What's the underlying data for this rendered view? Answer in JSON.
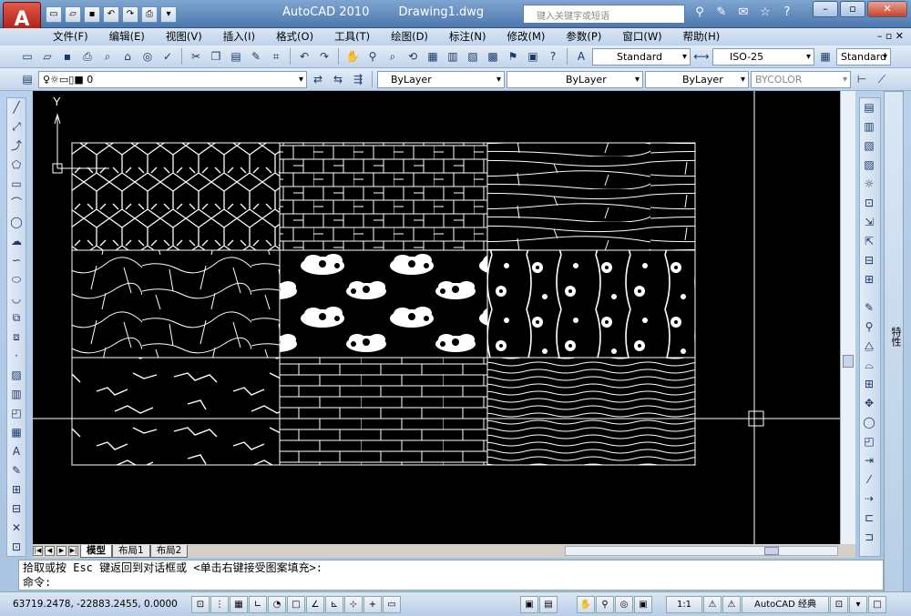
{
  "app": {
    "logo": "A",
    "name": "AutoCAD 2010",
    "document": "Drawing1.dwg",
    "search_placeholder": "键入关键字或短语"
  },
  "window_controls": {
    "minimize": "–",
    "restore": "▫",
    "close": "✕"
  },
  "menus": [
    "文件(F)",
    "编辑(E)",
    "视图(V)",
    "插入(I)",
    "格式(O)",
    "工具(T)",
    "绘图(D)",
    "标注(N)",
    "修改(M)",
    "参数(P)",
    "窗口(W)",
    "帮助(H)"
  ],
  "mdi_controls": "– ▫ ✕",
  "toolbar_styles": {
    "text_style": "Standard",
    "dim_style": "ISO-25",
    "table_style": "Standard"
  },
  "toolbar_layers": {
    "layer": "0",
    "color": "ByLayer",
    "linetype": "ByLayer",
    "lineweight": "ByLayer",
    "plotstyle": "BYCOLOR"
  },
  "ucs": {
    "y_label": "Y"
  },
  "tabs": [
    "模型",
    "布局1",
    "布局2"
  ],
  "command": {
    "history": "拾取或按 Esc 键返回到对话框或 <单击右键接受图案填充>:",
    "prompt": "命令:"
  },
  "status": {
    "coords": "63719.2478, -22883.2455, 0.0000",
    "annotation_scale": "1:1",
    "workspace": "AutoCAD 经典"
  },
  "properties_panel": {
    "label": "特性"
  },
  "hatch_patterns": [
    {
      "name": "islamic-star"
    },
    {
      "name": "brick-stack"
    },
    {
      "name": "slate-stone"
    },
    {
      "name": "cracked-earth"
    },
    {
      "name": "cloud-motif"
    },
    {
      "name": "floral-vine"
    },
    {
      "name": "marble-crack"
    },
    {
      "name": "running-bond"
    },
    {
      "name": "wave-lines"
    }
  ]
}
